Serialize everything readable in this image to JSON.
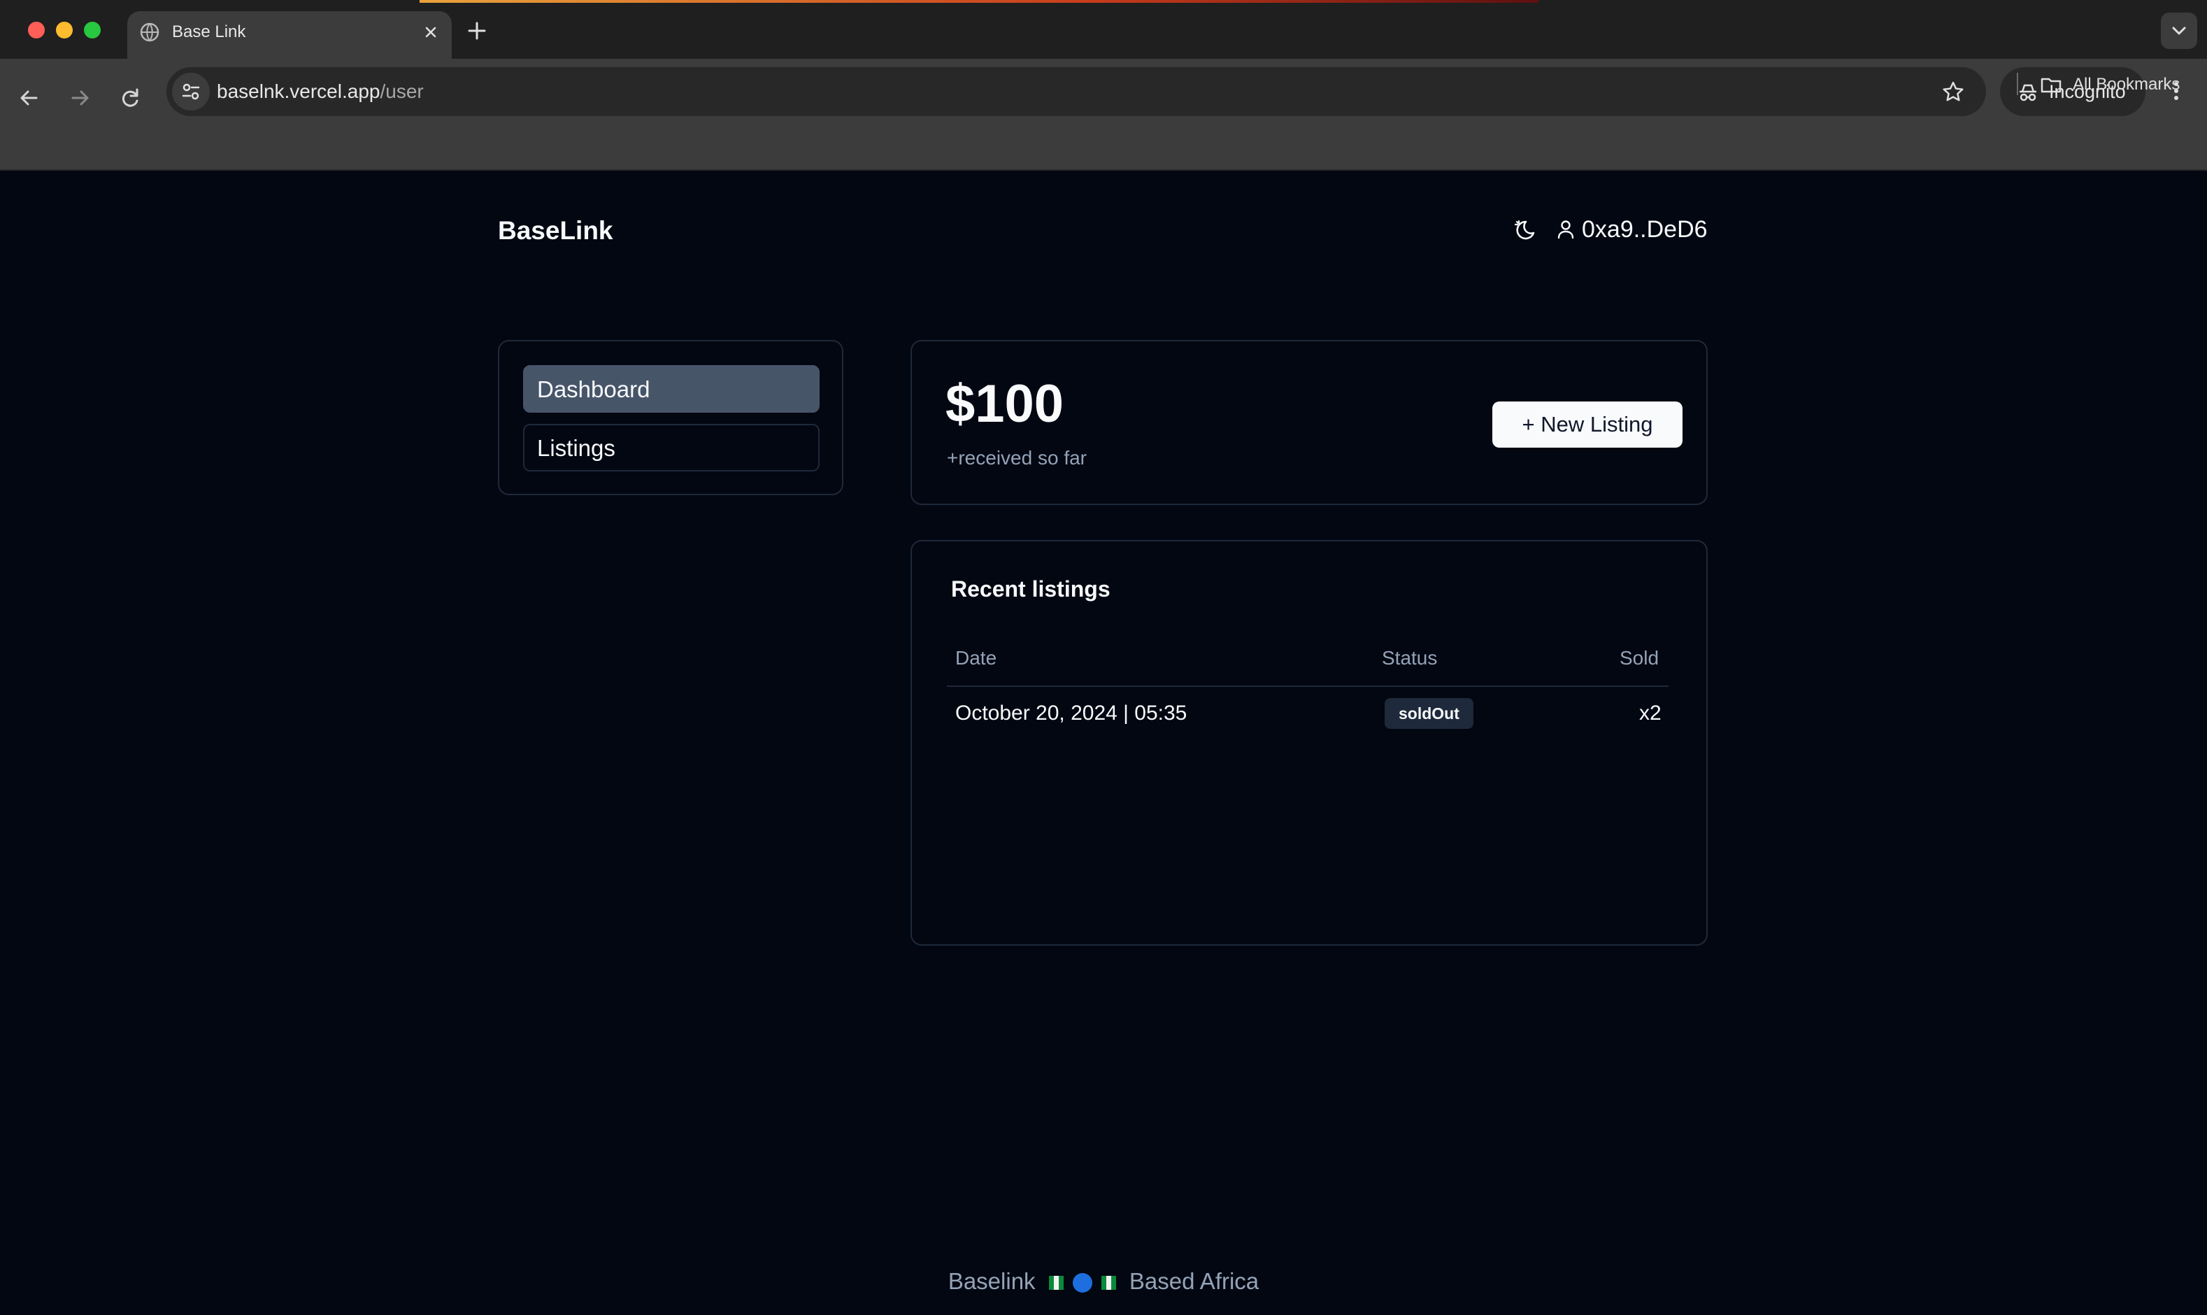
{
  "browser": {
    "tab_title": "Base Link",
    "url_host": "baselnk.vercel.app",
    "url_path": "/user",
    "incognito_label": "Incognito",
    "bookmarks_label": "All Bookmarks"
  },
  "header": {
    "logo": "BaseLink",
    "account": "0xa9..DeD6"
  },
  "sidebar": {
    "items": [
      {
        "label": "Dashboard",
        "active": true
      },
      {
        "label": "Listings",
        "active": false
      }
    ]
  },
  "stats": {
    "amount": "$100",
    "subtitle": "+received so far",
    "new_listing_button": "+ New Listing"
  },
  "recent": {
    "title": "Recent listings",
    "columns": [
      "Date",
      "Status",
      "Sold"
    ],
    "rows": [
      {
        "date": "October 20, 2024 | 05:35",
        "status": "soldOut",
        "sold": "x2"
      }
    ]
  },
  "footer": {
    "left": "Baselink",
    "right": "Based Africa"
  }
}
